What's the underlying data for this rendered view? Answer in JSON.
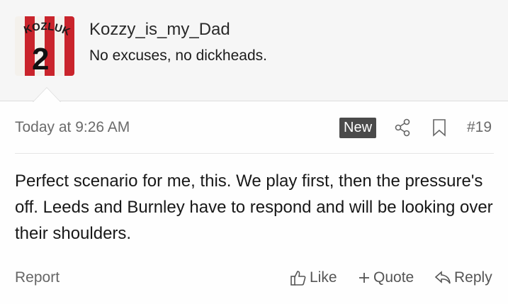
{
  "user": {
    "username": "Kozzy_is_my_Dad",
    "title": "No excuses, no dickheads.",
    "avatar": {
      "name_print": "KOZLUK",
      "number": "2",
      "colors": {
        "stripe_red": "#c9242c",
        "stripe_white": "#f4f1ec"
      }
    }
  },
  "meta": {
    "timestamp": "Today at 9:26 AM",
    "badge": "New",
    "post_number": "#19"
  },
  "post": {
    "body": "Perfect scenario for me, this. We play first, then the pressure's off. Leeds and Burnley have to respond and will be looking over their shoulders."
  },
  "actions": {
    "report": "Report",
    "like": "Like",
    "quote": "Quote",
    "reply": "Reply"
  },
  "icons": [
    "share-icon",
    "bookmark-icon",
    "thumbs-up-icon",
    "plus-icon",
    "reply-arrow-icon"
  ]
}
